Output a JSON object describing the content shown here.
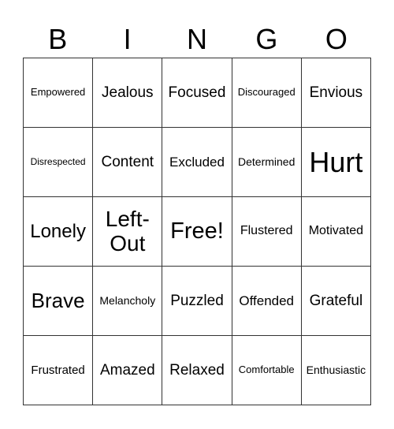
{
  "header": [
    "B",
    "I",
    "N",
    "G",
    "O"
  ],
  "cells": [
    [
      "Empowered",
      "Jealous",
      "Focused",
      "Discouraged",
      "Envious"
    ],
    [
      "Disrespected",
      "Content",
      "Excluded",
      "Determined",
      "Hurt"
    ],
    [
      "Lonely",
      "Left-Out",
      "Free!",
      "Flustered",
      "Motivated"
    ],
    [
      "Brave",
      "Melancholy",
      "Puzzled",
      "Offended",
      "Grateful"
    ],
    [
      "Frustrated",
      "Amazed",
      "Relaxed",
      "Comfortable",
      "Enthusiastic"
    ]
  ]
}
